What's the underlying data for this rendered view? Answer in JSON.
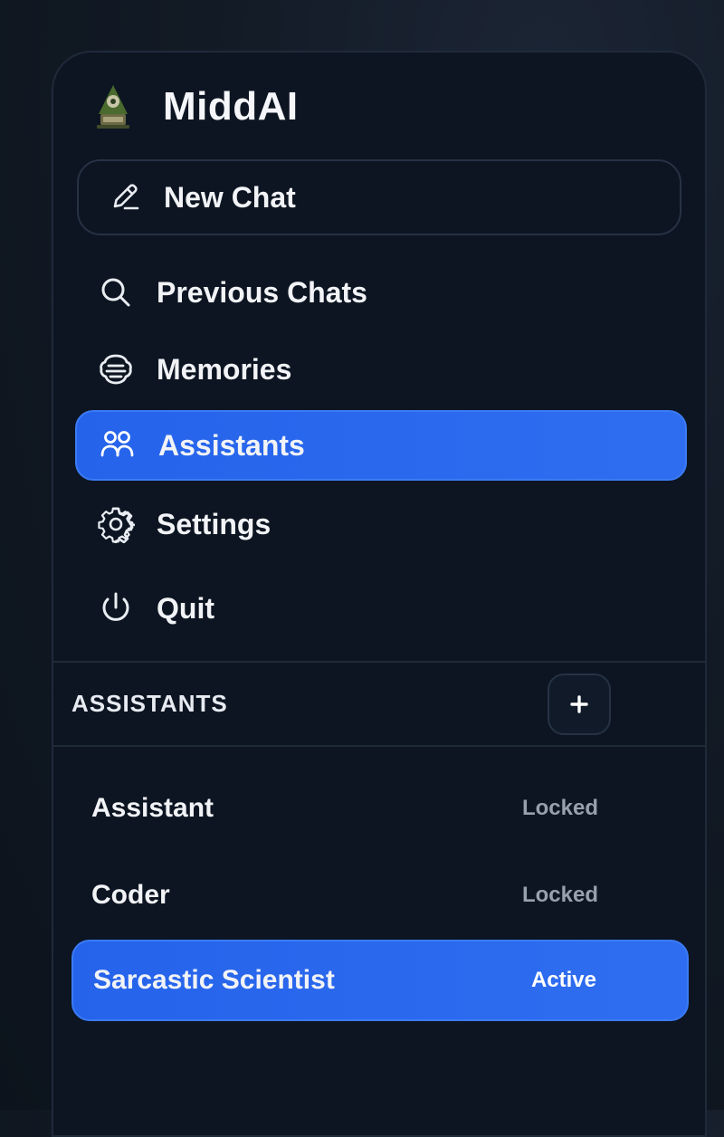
{
  "brand": {
    "name": "MiddAI"
  },
  "new_chat": {
    "label": "New Chat",
    "icon": "pencil-icon"
  },
  "nav": [
    {
      "label": "Previous Chats",
      "icon": "search-icon",
      "active": false
    },
    {
      "label": "Memories",
      "icon": "brain-icon",
      "active": false
    },
    {
      "label": "Assistants",
      "icon": "users-icon",
      "active": true
    },
    {
      "label": "Settings",
      "icon": "gear-icon",
      "active": false
    },
    {
      "label": "Quit",
      "icon": "power-icon",
      "active": false
    }
  ],
  "assistants_section": {
    "title": "ASSISTANTS",
    "add_label": "+"
  },
  "assistants": [
    {
      "name": "Assistant",
      "status": "Locked"
    },
    {
      "name": "Coder",
      "status": "Locked"
    },
    {
      "name": "Sarcastic Scientist",
      "status": "Active"
    }
  ],
  "colors": {
    "accent": "#2563eb",
    "panel": "#0d1522",
    "border": "#1f2a39",
    "muted_text": "#97a0ad"
  }
}
